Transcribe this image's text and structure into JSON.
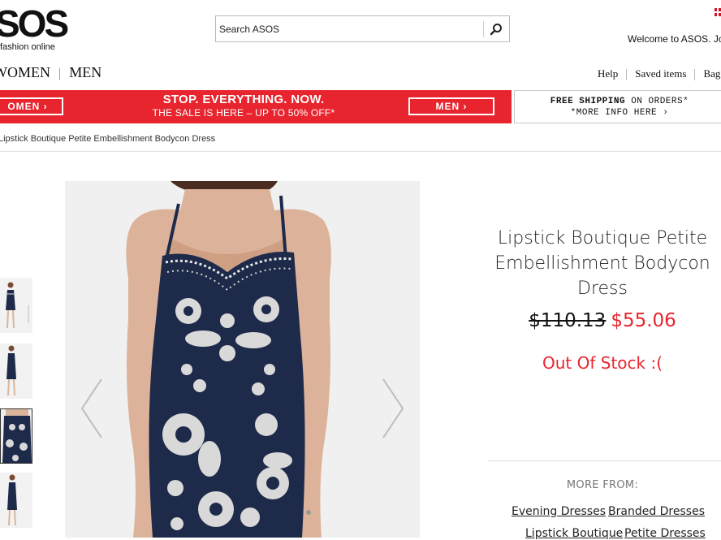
{
  "header": {
    "logo_text": "SOS",
    "logo_tagline": "fashion online",
    "welcome": "Welcome to ASOS.  Jo"
  },
  "search": {
    "placeholder": "Search ASOS",
    "value": "",
    "button_icon": "search-icon"
  },
  "gender_nav": {
    "women": "WOMEN",
    "men": "MEN"
  },
  "utility_nav": {
    "help": "Help",
    "saved": "Saved items",
    "bag": "Bag"
  },
  "promo": {
    "women_button": "OMEN ›",
    "title": "STOP. EVERYTHING. NOW.",
    "subtitle": "THE SALE IS HERE – UP TO 50% OFF*",
    "men_button": "MEN ›",
    "color": "#e8252e"
  },
  "shipping": {
    "line1_bold": "FREE SHIPPING",
    "line1_rest": " ON ORDERS*",
    "line2": "*MORE INFO HERE ›"
  },
  "breadcrumb": "Lipstick Boutique Petite Embellishment Bodycon Dress",
  "product": {
    "title": "Lipstick Boutique Petite Embellishment Bodycon Dress",
    "old_price": "$110.13",
    "new_price": "$55.06",
    "stock_status": "Out Of Stock :(",
    "dress_color": "#1e2a4a"
  },
  "thumbnails": {
    "selected_index": 2,
    "count": 4
  },
  "more_from": {
    "heading": "MORE FROM:",
    "links": [
      "Evening Dresses",
      "Branded Dresses",
      "Lipstick Boutique",
      "Petite Dresses"
    ]
  }
}
